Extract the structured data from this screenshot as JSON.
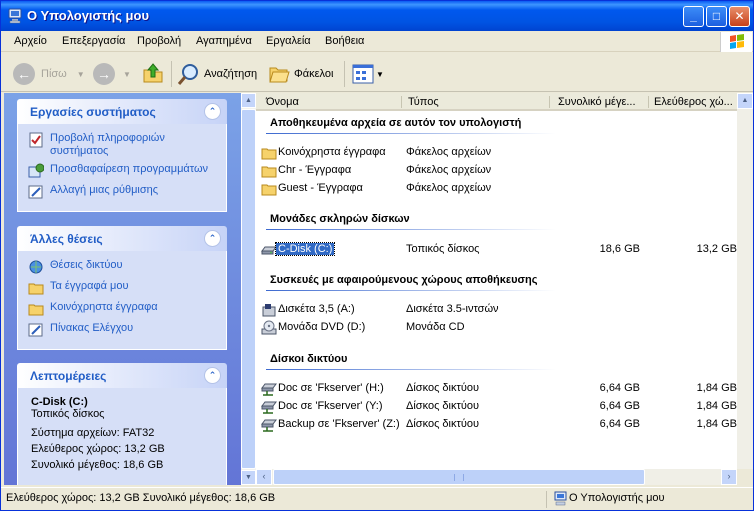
{
  "window": {
    "title": "Ο Υπολογιστής μου",
    "controls": {
      "minimize": "_",
      "maximize": "□",
      "close": "✕"
    }
  },
  "menu": [
    "Αρχείο",
    "Επεξεργασία",
    "Προβολή",
    "Αγαπημένα",
    "Εργαλεία",
    "Βοήθεια"
  ],
  "toolbar": {
    "back_label": "Πίσω",
    "forward_label": "",
    "search_label": "Αναζήτηση",
    "folders_label": "Φάκελοι"
  },
  "left": {
    "system_tasks": {
      "title": "Εργασίες συστήματος",
      "items": [
        "Προβολή πληροφοριών συστήματος",
        "Προσθαφαίρεση προγραμμάτων",
        "Αλλαγή μιας ρύθμισης"
      ]
    },
    "other_places": {
      "title": "Άλλες θέσεις",
      "items": [
        "Θέσεις δικτύου",
        "Τα έγγραφά μου",
        "Κοινόχρηστα έγγραφα",
        "Πίνακας Ελέγχου"
      ]
    },
    "details": {
      "title": "Λεπτομέρειες",
      "name": "C-Disk (C:)",
      "kind": "Τοπικός δίσκος",
      "filesystem": "Σύστημα αρχείων: FAT32",
      "free": "Ελεύθερος χώρος: 13,2 GB",
      "total": "Συνολικό μέγεθος: 18,6 GB"
    }
  },
  "columns": [
    "Όνομα",
    "Τύπος",
    "Συνολικό μέγε...",
    "Ελεύθερος χώ..."
  ],
  "groups": [
    {
      "title": "Αποθηκευμένα αρχεία σε αυτόν τον υπολογιστή",
      "rows": [
        {
          "name": "Κοινόχρηστα έγγραφα",
          "type": "Φάκελος αρχείων",
          "total": "",
          "free": "",
          "icon": "folder-icon"
        },
        {
          "name": "Chr - Έγγραφα",
          "type": "Φάκελος αρχείων",
          "total": "",
          "free": "",
          "icon": "folder-icon"
        },
        {
          "name": "Guest - Έγγραφα",
          "type": "Φάκελος αρχείων",
          "total": "",
          "free": "",
          "icon": "folder-icon"
        }
      ]
    },
    {
      "title": "Μονάδες σκληρών δίσκων",
      "rows": [
        {
          "name": "C-Disk (C:)",
          "type": "Τοπικός δίσκος",
          "total": "18,6 GB",
          "free": "13,2 GB",
          "icon": "hard-disk-icon",
          "selected": true
        }
      ]
    },
    {
      "title": "Συσκευές με αφαιρούμενους χώρους αποθήκευσης",
      "rows": [
        {
          "name": "Δισκέτα 3,5 (A:)",
          "type": "Δισκέτα 3.5-ιντσών",
          "total": "",
          "free": "",
          "icon": "floppy-drive-icon"
        },
        {
          "name": "Μονάδα DVD (D:)",
          "type": "Μονάδα CD",
          "total": "",
          "free": "",
          "icon": "dvd-drive-icon"
        }
      ]
    },
    {
      "title": "Δίσκοι δικτύου",
      "rows": [
        {
          "name": "Doc σε 'Fkserver' (H:)",
          "type": "Δίσκος δικτύου",
          "total": "6,64 GB",
          "free": "1,84 GB",
          "icon": "network-drive-icon"
        },
        {
          "name": "Doc σε 'Fkserver' (Y:)",
          "type": "Δίσκος δικτύου",
          "total": "6,64 GB",
          "free": "1,84 GB",
          "icon": "network-drive-icon"
        },
        {
          "name": "Backup σε 'Fkserver' (Z:)",
          "type": "Δίσκος δικτύου",
          "total": "6,64 GB",
          "free": "1,84 GB",
          "icon": "network-drive-icon"
        }
      ]
    }
  ],
  "status": {
    "left": "Ελεύθερος χώρος: 13,2 GB Συνολικό μέγεθος: 18,6 GB",
    "right": "Ο Υπολογιστής μου"
  }
}
